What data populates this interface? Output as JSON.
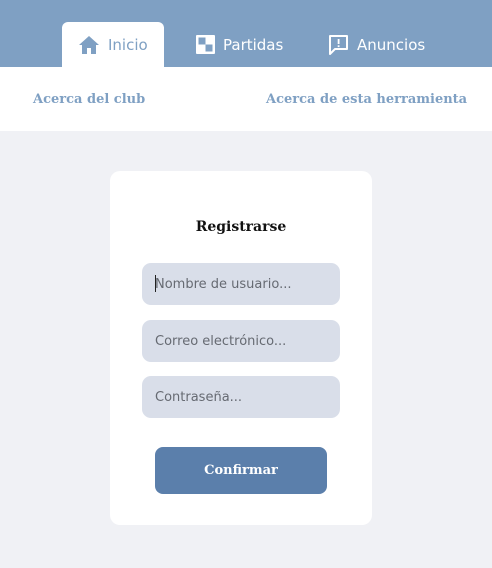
{
  "nav": {
    "tabs": [
      {
        "label": "Inicio",
        "icon": "home-icon",
        "active": true
      },
      {
        "label": "Partidas",
        "icon": "board-icon",
        "active": false
      },
      {
        "label": "Anuncios",
        "icon": "announcement-icon",
        "active": false
      }
    ]
  },
  "subnav": {
    "about_club": "Acerca del club",
    "about_tool": "Acerca de esta herramienta"
  },
  "form": {
    "title": "Registrarse",
    "username_placeholder": "Nombre de usuario...",
    "email_placeholder": "Correo electrónico...",
    "password_placeholder": "Contraseña...",
    "confirm_label": "Confirmar"
  },
  "colors": {
    "header": "#7fa0c3",
    "background": "#f0f1f5",
    "input": "#d9dee9",
    "button": "#5b7fab"
  }
}
